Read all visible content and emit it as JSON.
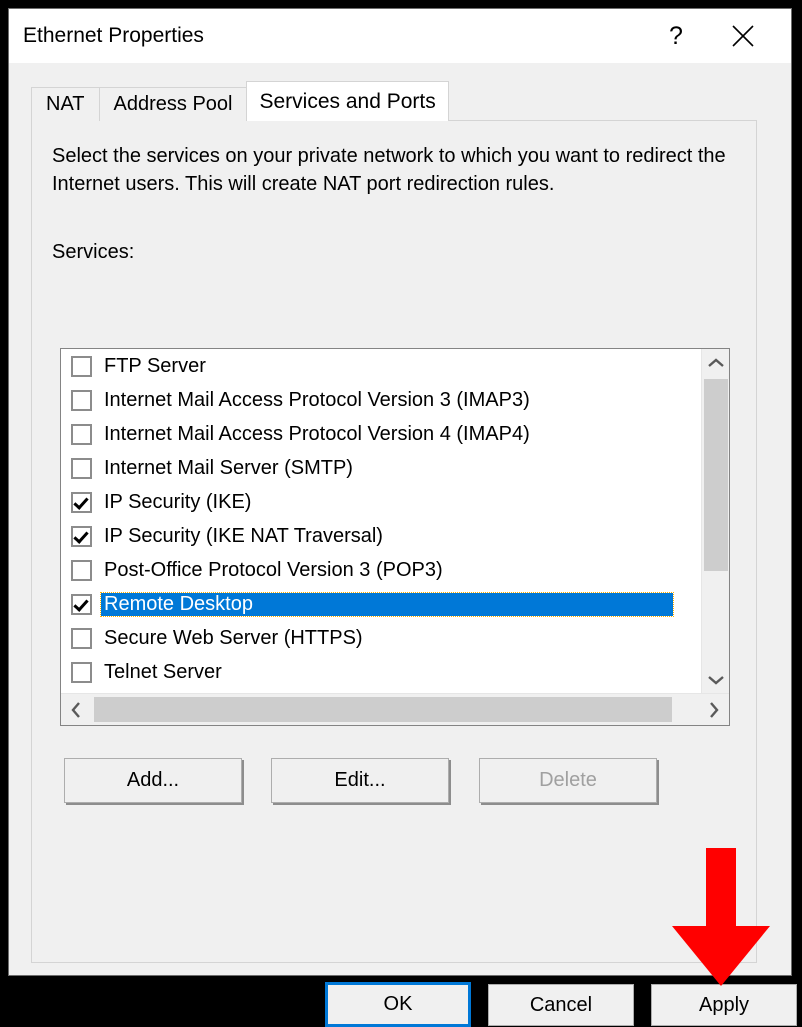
{
  "window": {
    "title": "Ethernet Properties",
    "help_icon": "question-mark-icon",
    "close_icon": "close-icon"
  },
  "tabs": [
    {
      "label": "NAT",
      "active": false
    },
    {
      "label": "Address Pool",
      "active": false
    },
    {
      "label": "Services and Ports",
      "active": true
    }
  ],
  "page": {
    "description": "Select the services on your private network to which you want to redirect the Internet users. This will create NAT port redirection rules.",
    "services_label": "Services:"
  },
  "services": [
    {
      "label": "FTP Server",
      "checked": false,
      "selected": false
    },
    {
      "label": "Internet Mail Access Protocol Version 3 (IMAP3)",
      "checked": false,
      "selected": false
    },
    {
      "label": "Internet Mail Access Protocol Version 4 (IMAP4)",
      "checked": false,
      "selected": false
    },
    {
      "label": "Internet Mail Server (SMTP)",
      "checked": false,
      "selected": false
    },
    {
      "label": "IP Security (IKE)",
      "checked": true,
      "selected": false
    },
    {
      "label": "IP Security (IKE NAT Traversal)",
      "checked": true,
      "selected": false
    },
    {
      "label": "Post-Office Protocol Version 3 (POP3)",
      "checked": false,
      "selected": false
    },
    {
      "label": "Remote Desktop",
      "checked": true,
      "selected": true
    },
    {
      "label": "Secure Web Server (HTTPS)",
      "checked": false,
      "selected": false
    },
    {
      "label": "Telnet Server",
      "checked": false,
      "selected": false
    }
  ],
  "scrollbars": {
    "vertical_up_icon": "chevron-up-icon",
    "vertical_down_icon": "chevron-down-icon",
    "horizontal_left_icon": "chevron-left-icon",
    "horizontal_right_icon": "chevron-right-icon"
  },
  "list_buttons": {
    "add": "Add...",
    "edit": "Edit...",
    "delete": "Delete",
    "delete_disabled": true
  },
  "dialog_buttons": {
    "ok": "OK",
    "cancel": "Cancel",
    "apply": "Apply"
  },
  "annotation": {
    "arrow_icon": "red-down-arrow-icon",
    "color": "#FF0000",
    "points_at": "Apply"
  },
  "colors": {
    "selection": "#0078D7",
    "focus_border": "#0078D7",
    "window_bg": "#F0F0F0",
    "list_bg": "#FFFFFF",
    "scroll_thumb": "#CDCDCD",
    "disabled_text": "#A0A0A0"
  }
}
